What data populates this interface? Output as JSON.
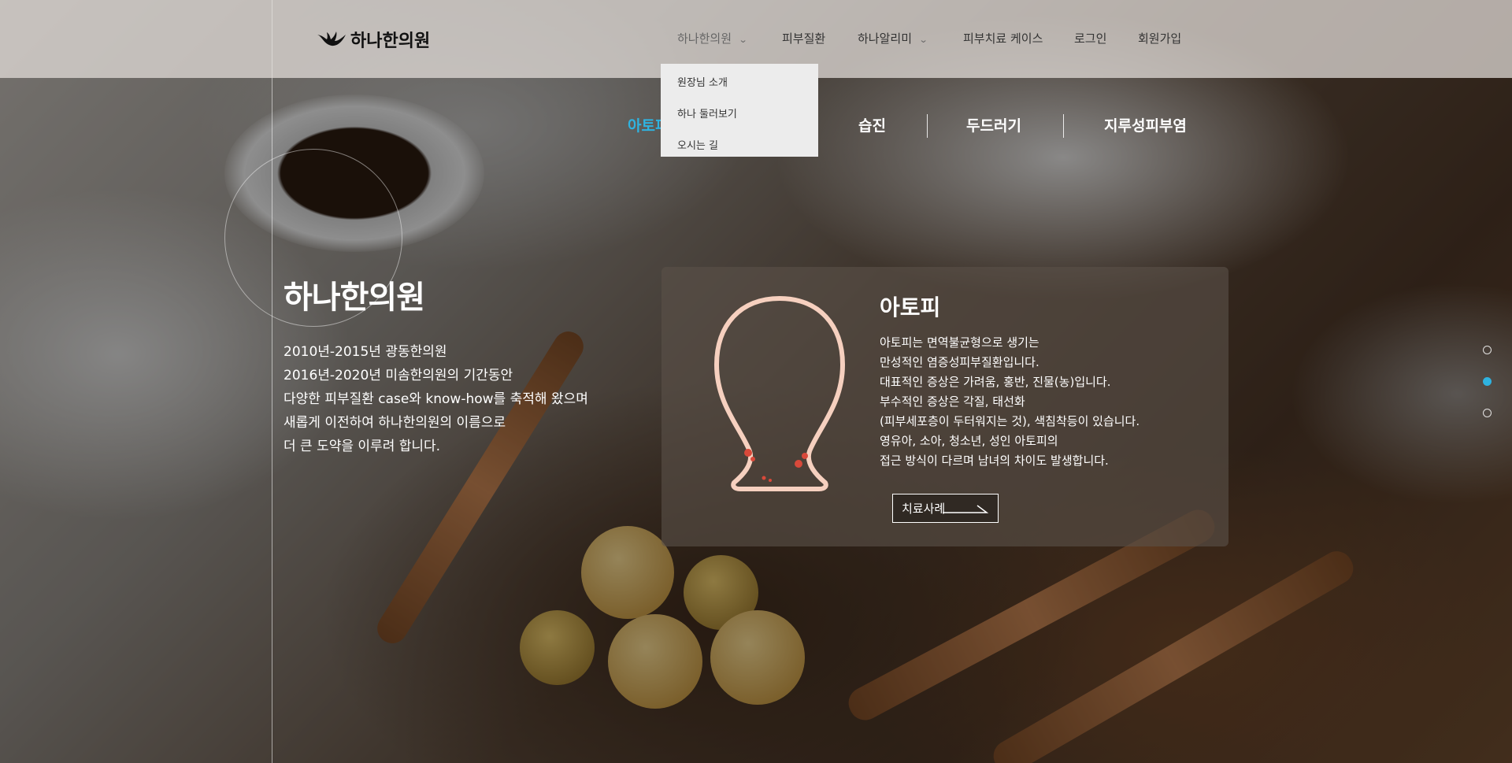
{
  "brand": {
    "logo_text": "하나한의원"
  },
  "nav": {
    "items": [
      {
        "label": "하나한의원",
        "has_dropdown": true
      },
      {
        "label": "피부질환",
        "has_dropdown": false
      },
      {
        "label": "하나알리미",
        "has_dropdown": true
      },
      {
        "label": "피부치료 케이스",
        "has_dropdown": false
      },
      {
        "label": "로그인",
        "has_dropdown": false
      },
      {
        "label": "회원가입",
        "has_dropdown": false
      }
    ],
    "dropdown": [
      "원장님 소개",
      "하나 둘러보기",
      "오시는 길"
    ]
  },
  "tabs": [
    {
      "label": "아토피",
      "active": true
    },
    {
      "label": "습진",
      "active": false
    },
    {
      "label": "두드러기",
      "active": false
    },
    {
      "label": "지루성피부염",
      "active": false
    }
  ],
  "intro": {
    "title": "하나한의원",
    "lines": [
      "2010년-2015년 광동한의원",
      "2016년-2020년 미솜한의원의 기간동안",
      "다양한 피부질환 case와 know-how를 축적해 왔으며",
      "새롭게 이전하여 하나한의원의 이름으로",
      "더 큰 도약을 이루려 합니다."
    ]
  },
  "panel": {
    "title": "아토피",
    "lines": [
      "아토피는 면역불균형으로 생기는",
      "만성적인 염증성피부질환입니다.",
      "대표적인 증상은 가려움, 홍반, 진물(농)입니다.",
      "부수적인 증상은 각질, 태선화",
      "(피부세포층이 두터워지는 것), 색침착등이 있습니다.",
      "영유아, 소아, 청소년, 성인 아토피의",
      "접근 방식이 다르며 남녀의 차이도 발생합니다."
    ],
    "button_label": "치료사례"
  },
  "pager": {
    "count": 3,
    "active_index": 1
  },
  "colors": {
    "accent": "#2fb3e0",
    "figure_stroke": "#f6d0bf",
    "figure_spot": "#d8493a"
  },
  "icons": {
    "logo": "hand-wave-logo-icon",
    "dropdown": "chevron-down-icon",
    "button": "arrow-right-icon"
  }
}
